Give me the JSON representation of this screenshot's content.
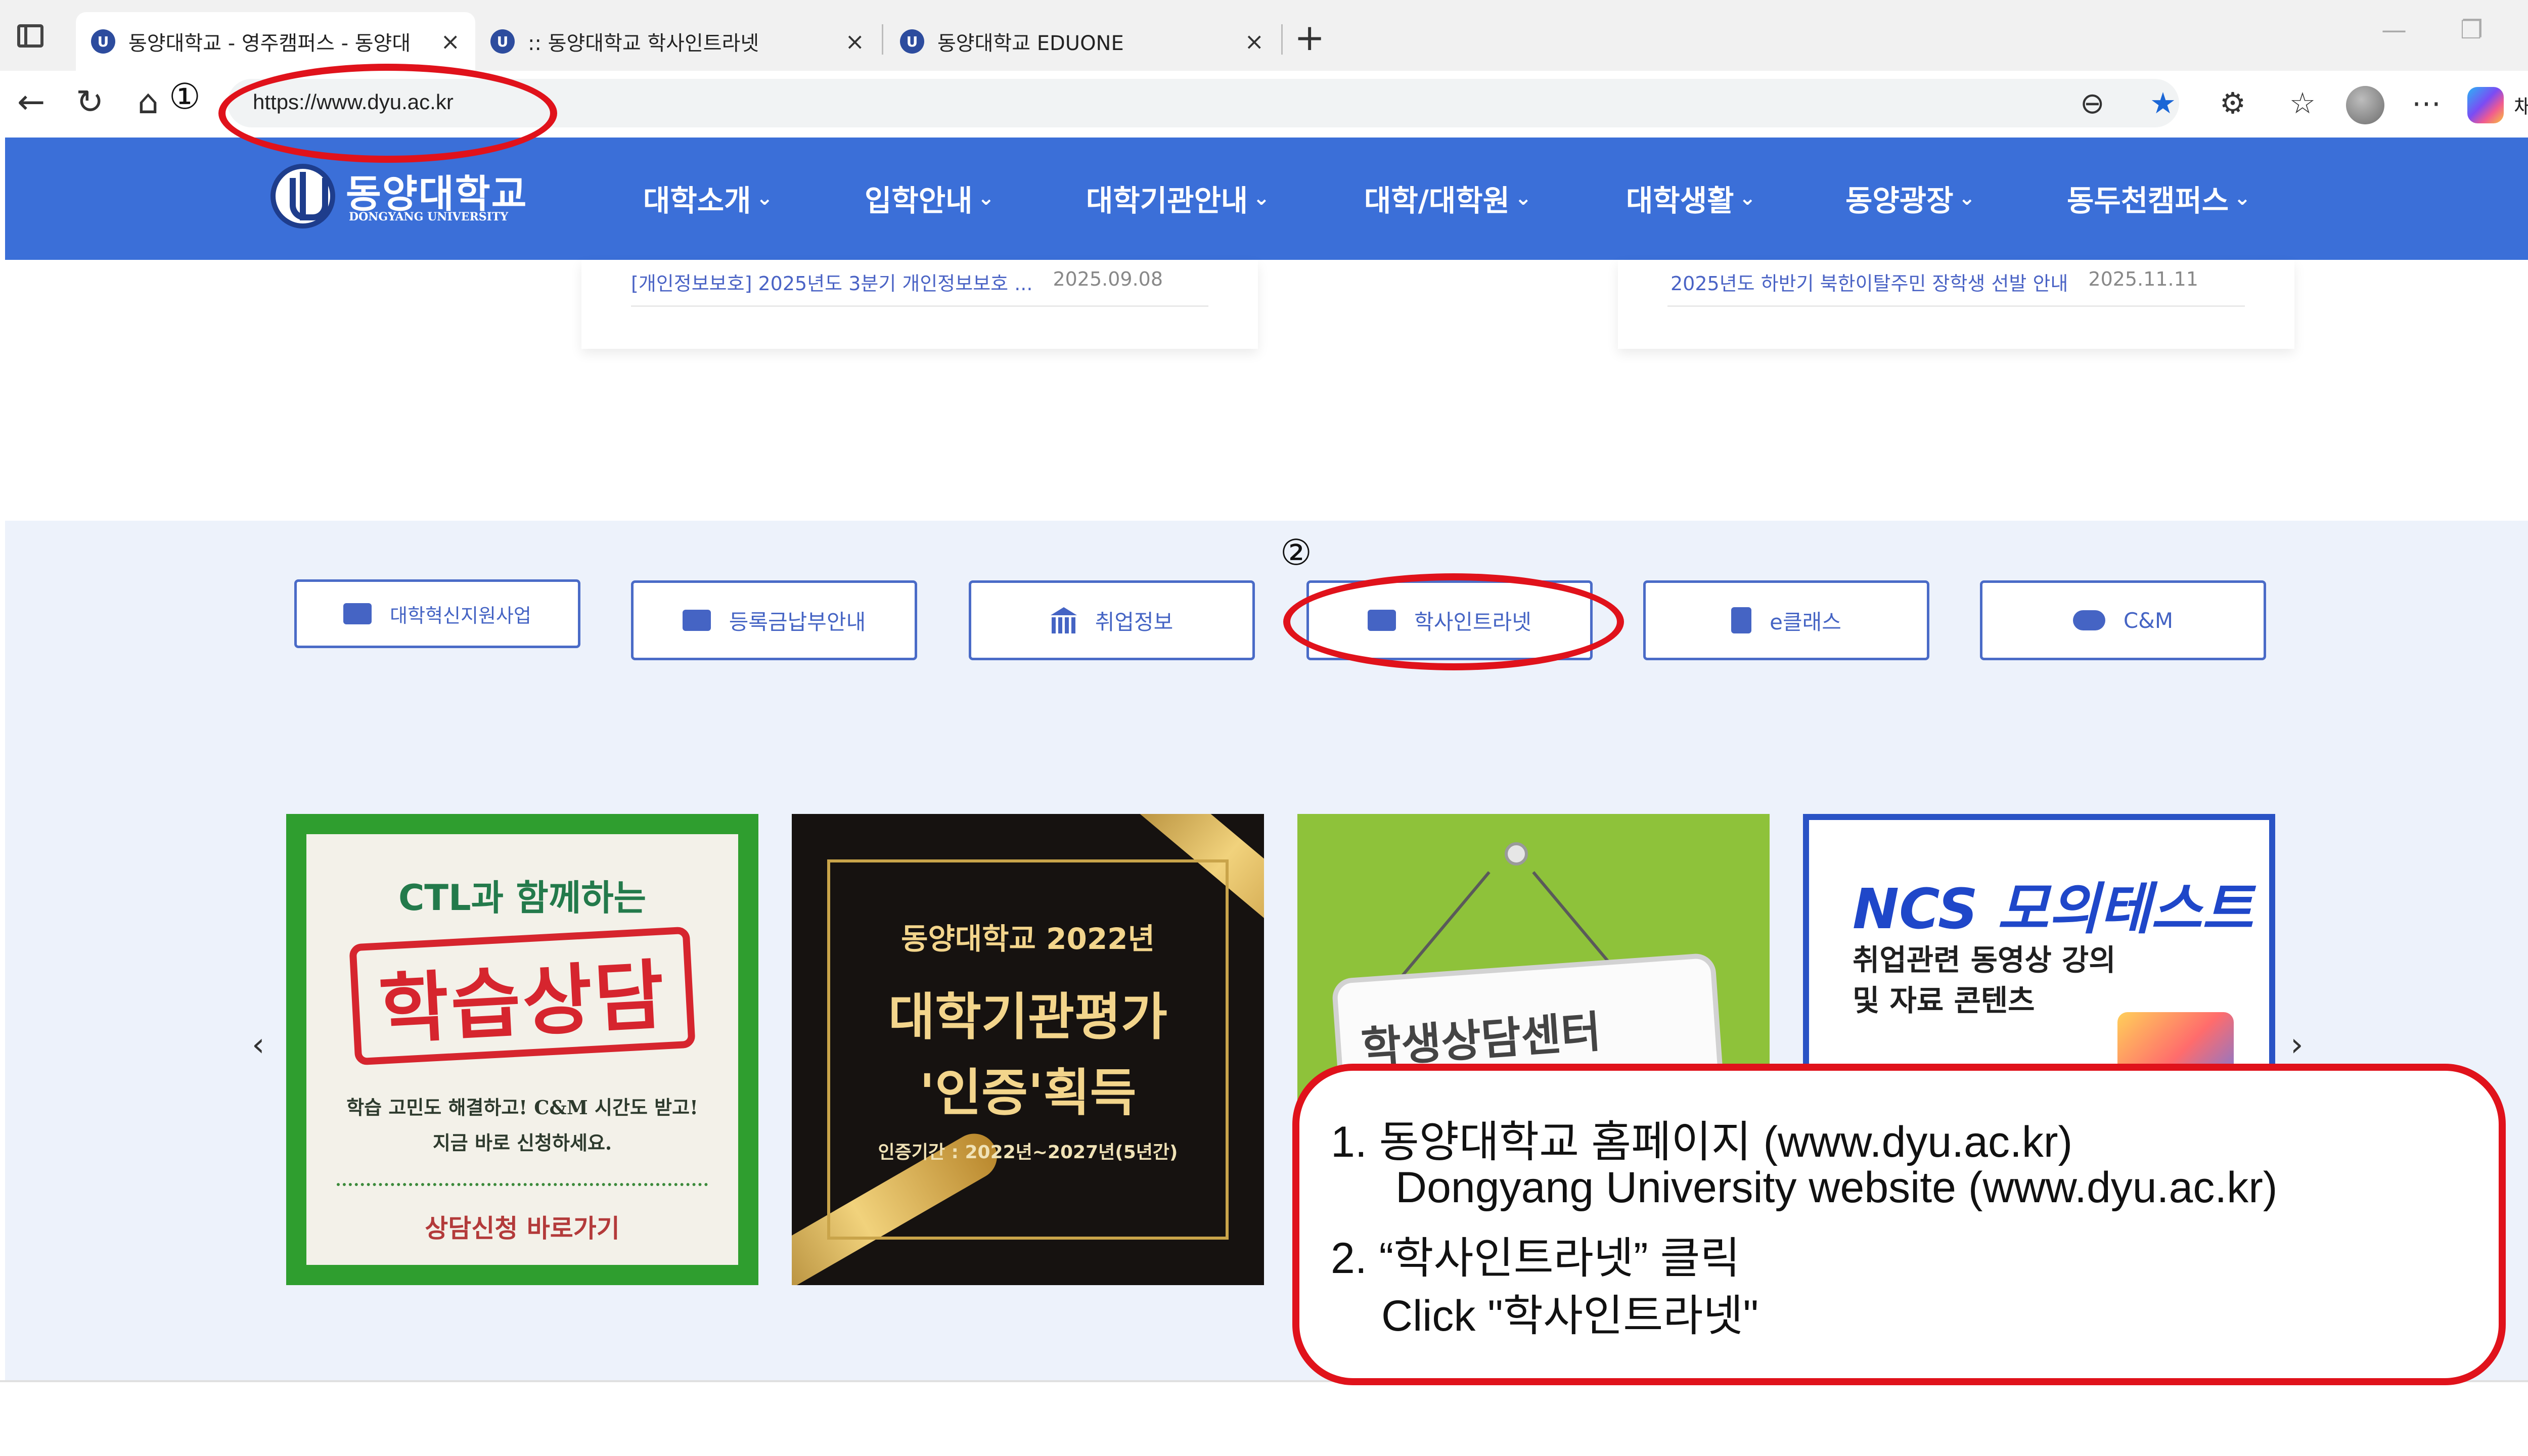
{
  "browser": {
    "tabs": [
      {
        "title": "동양대학교 - 영주캠퍼스 - 동양대",
        "active": true
      },
      {
        "title": ":: 동양대학교 학사인트라넷",
        "active": false
      },
      {
        "title": "동양대학교 EDUONE",
        "active": false
      }
    ],
    "address_bar": {
      "url": "https://www.dyu.ac.kr"
    },
    "copilot_label": "채팅",
    "icons": [
      "tab-actions-icon",
      "back-icon",
      "refresh-icon",
      "home-icon",
      "reader-icon",
      "favorite-star-icon",
      "extensions-icon",
      "collections-icon",
      "profile-avatar",
      "more-icon",
      "copilot-icon"
    ]
  },
  "site": {
    "logo": {
      "name": "동양대학교",
      "subtitle": "DONGYANG UNIVERSITY"
    },
    "nav": [
      "대학소개",
      "입학안내",
      "대학기관안내",
      "대학/대학원",
      "대학생활",
      "동양광장",
      "동두천캠퍼스"
    ],
    "notices": [
      {
        "title": "[개인정보보호] 2025년도 3분기 개인정보보호 ...",
        "date": "2025.09.08"
      },
      {
        "title": "2025년도 하반기 북한이탈주민 장학생 선발 안내",
        "date": "2025.11.11"
      }
    ],
    "quick_links": [
      {
        "label": "대학혁신지원사업",
        "icon": "id-card-icon"
      },
      {
        "label": "등록금납부안내",
        "icon": "visa-card-icon"
      },
      {
        "label": "취업정보",
        "icon": "bank-icon"
      },
      {
        "label": "학사인트라넷",
        "icon": "id-badge-icon"
      },
      {
        "label": "e클래스",
        "icon": "book-icon"
      },
      {
        "label": "C&M",
        "icon": "handshake-icon"
      }
    ],
    "banners": {
      "learning": {
        "title": "CTL과 함께하는",
        "stamp": "학습상담",
        "line1": "학습 고민도 해결하고! C&M 시간도 받고!",
        "line2": "지금 바로 신청하세요.",
        "cta": "상담신청 바로가기"
      },
      "accreditation": {
        "line1": "동양대학교 2022년",
        "line2": "대학기관평가",
        "line3": "'인증'획득",
        "period": "인증기간 : 2022년~2027년(5년간)"
      },
      "counseling": {
        "sign": "학생상담센터"
      },
      "ncs": {
        "title": "NCS 모의테스트",
        "line1": "취업관련 동영상 강의",
        "line2": "및 자료 콘텐츠"
      }
    },
    "carousel": {
      "prev": "‹",
      "next": "›"
    }
  },
  "annotations": {
    "step1": "①",
    "step2": "②",
    "callout": {
      "line1": "1. 동양대학교 홈페이지 (www.dyu.ac.kr)",
      "line2": "Dongyang University website (www.dyu.ac.kr)",
      "line3": "2. “학사인트라넷” 클릭",
      "line4": "Click \"학사인트라넷\""
    }
  }
}
